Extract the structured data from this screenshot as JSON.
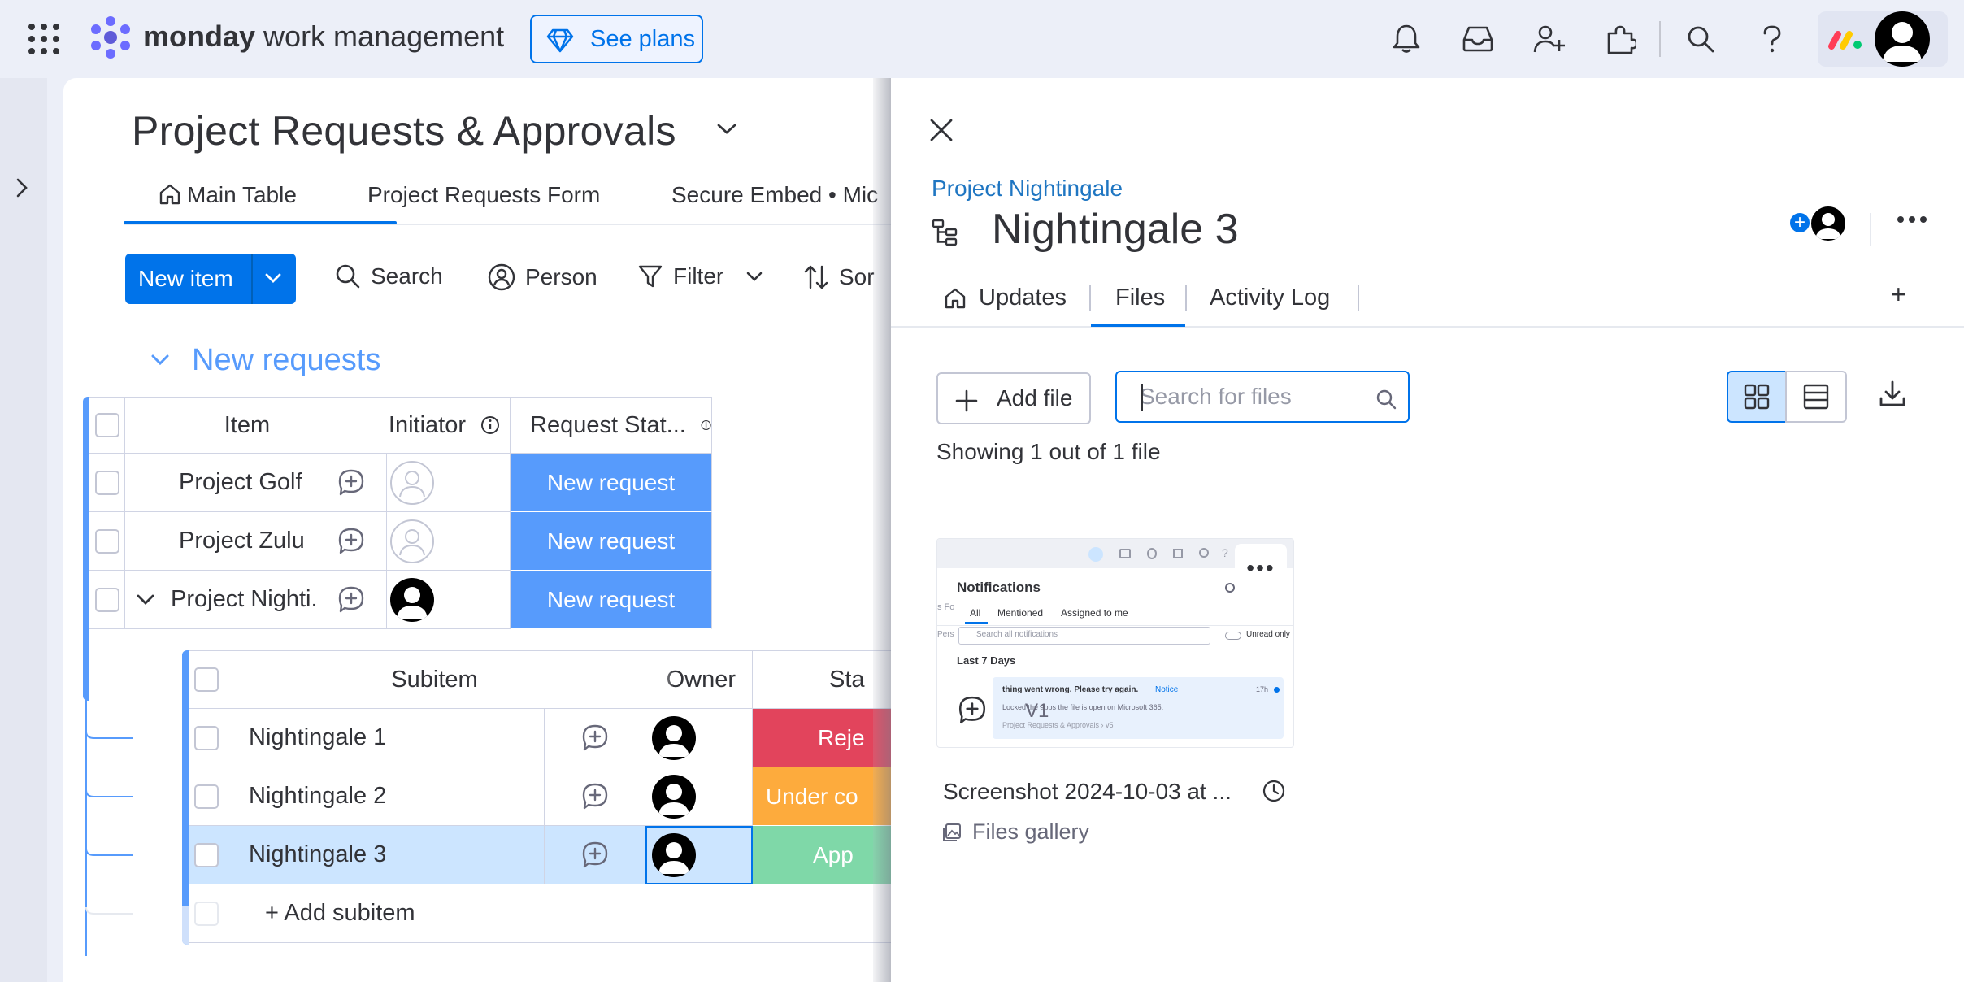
{
  "app": {
    "brand": "monday",
    "brand_suffix": "work management",
    "see_plans": "See plans",
    "colors": {
      "primary": "#0073ea",
      "group": "#579bfc",
      "rejected": "#e2445c",
      "under": "#fdab3d",
      "approved": "#00c875"
    }
  },
  "board": {
    "title": "Project Requests & Approvals",
    "tabs": [
      {
        "label": "Main Table"
      },
      {
        "label": "Project Requests Form"
      },
      {
        "label": "Secure Embed • Mic"
      }
    ],
    "toolbar": {
      "new_item": "New item",
      "search": "Search",
      "person": "Person",
      "filter": "Filter",
      "sort": "Sor"
    },
    "group": {
      "title": "New requests",
      "columns": {
        "item": "Item",
        "initiator": "Initiator",
        "status": "Request Stat..."
      },
      "rows": [
        {
          "name": "Project Golf",
          "status": "New request"
        },
        {
          "name": "Project Zulu",
          "status": "New request"
        },
        {
          "name": "Project Nighti...",
          "count": "3",
          "status": "New request"
        }
      ]
    },
    "subitems": {
      "columns": {
        "subitem": "Subitem",
        "owner": "Owner",
        "status": "Sta"
      },
      "rows": [
        {
          "name": "Nightingale 1",
          "status": "Reje"
        },
        {
          "name": "Nightingale 2",
          "status": "Under co"
        },
        {
          "name": "Nightingale 3",
          "status": "App"
        }
      ],
      "add_label": "+ Add subitem"
    }
  },
  "panel": {
    "parent_link": "Project Nightingale",
    "title": "Nightingale 3",
    "tabs": [
      {
        "label": "Updates"
      },
      {
        "label": "Files"
      },
      {
        "label": "Activity Log"
      }
    ],
    "add_tab": "+",
    "add_file": "Add file",
    "search_placeholder": "Search for files",
    "showing": "Showing 1 out of 1 file",
    "file": {
      "name": "Screenshot 2024-10-03 at ...",
      "version": "V1",
      "gallery": "Files gallery",
      "preview": {
        "title": "Notifications",
        "tabs": [
          "All",
          "Mentioned",
          "Assigned to me"
        ],
        "search": "Search all notifications",
        "toggle": "Unread only",
        "section": "Last 7 Days",
        "line1": "thing went wrong. Please try again.",
        "notice": "Notice",
        "time": "17h",
        "line2": "Locked the apps the file is open on Microsoft 365.",
        "line3": "Project Requests & Approvals › v5"
      }
    }
  }
}
